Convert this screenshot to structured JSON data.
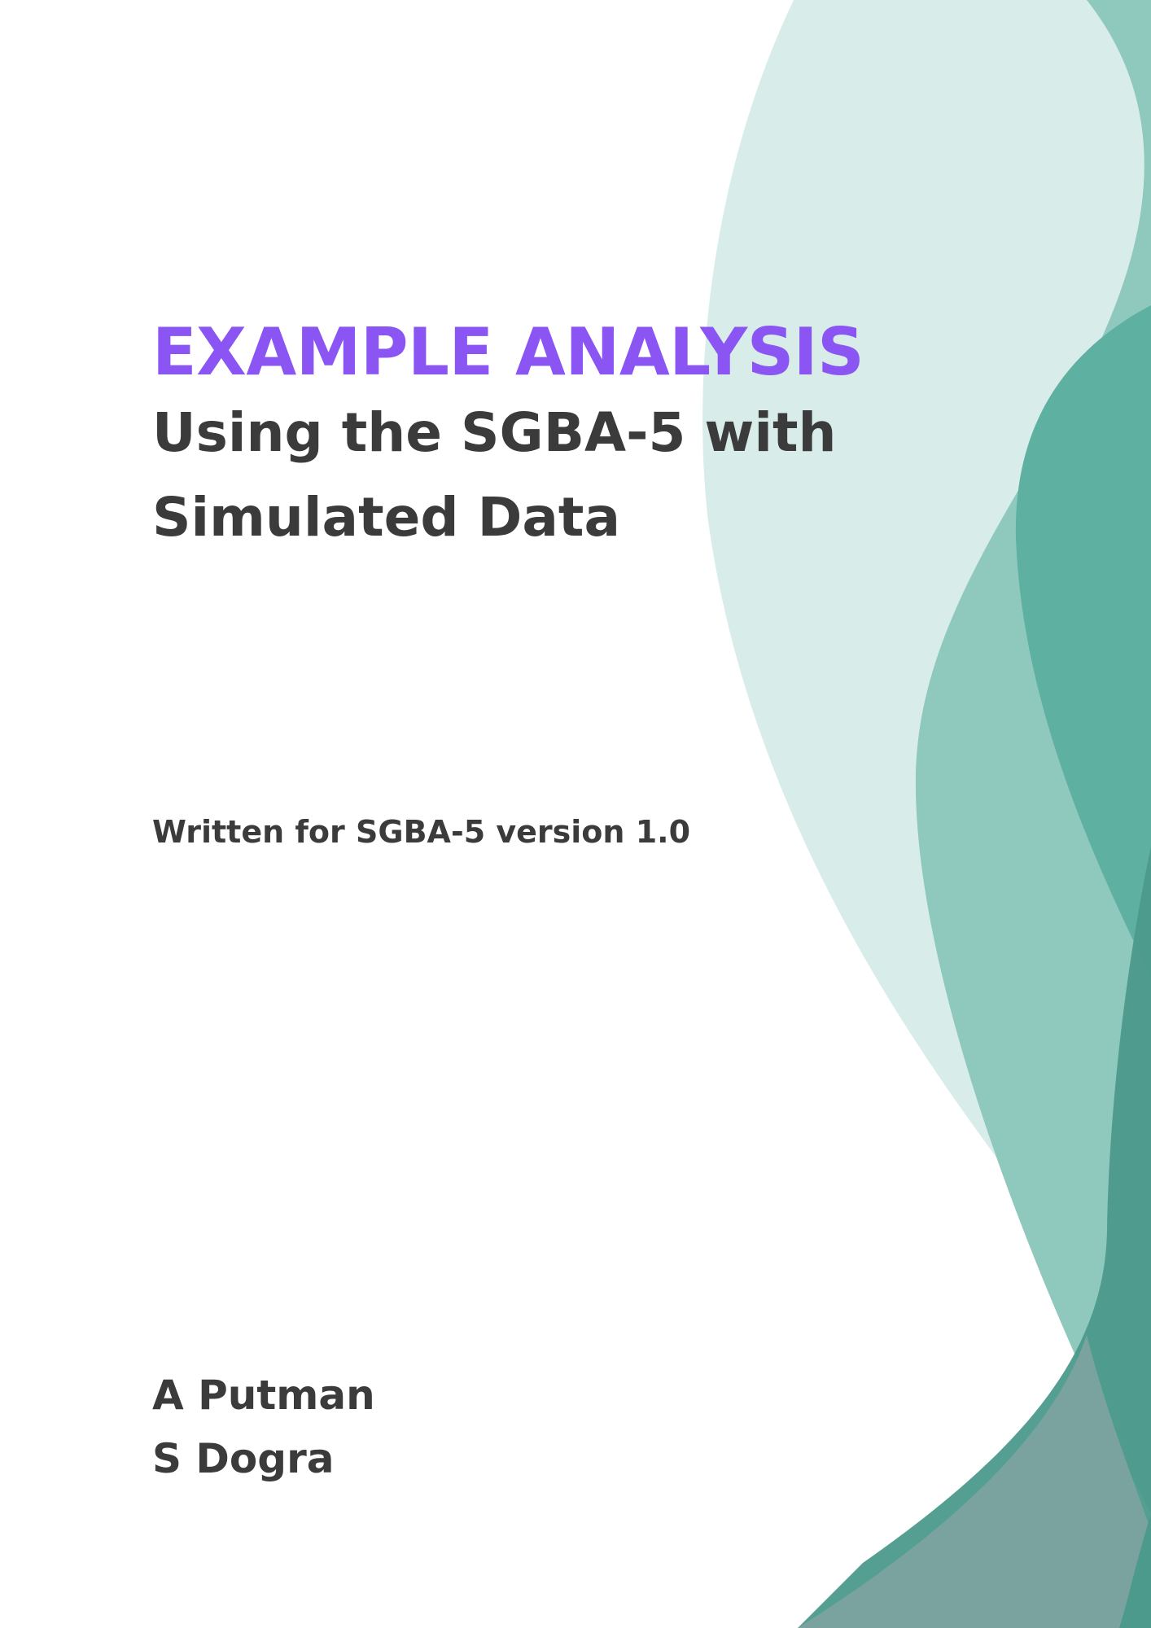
{
  "cover": {
    "kicker": "EXAMPLE ANALYSIS",
    "title": "Using the SGBA-5 with Simulated Data",
    "version_note": "Written for SGBA-5 version 1.0",
    "authors": [
      "A Putman",
      "S Dogra"
    ]
  },
  "colors": {
    "kicker": "#8b55f4",
    "text": "#3b3b3b",
    "wave_light": "#d8ede9",
    "wave_mid": "#8fc8bd",
    "wave_teal": "#5eb0a1",
    "wave_dark": "#4c9a8c",
    "wave_slate": "#7aa39f"
  }
}
